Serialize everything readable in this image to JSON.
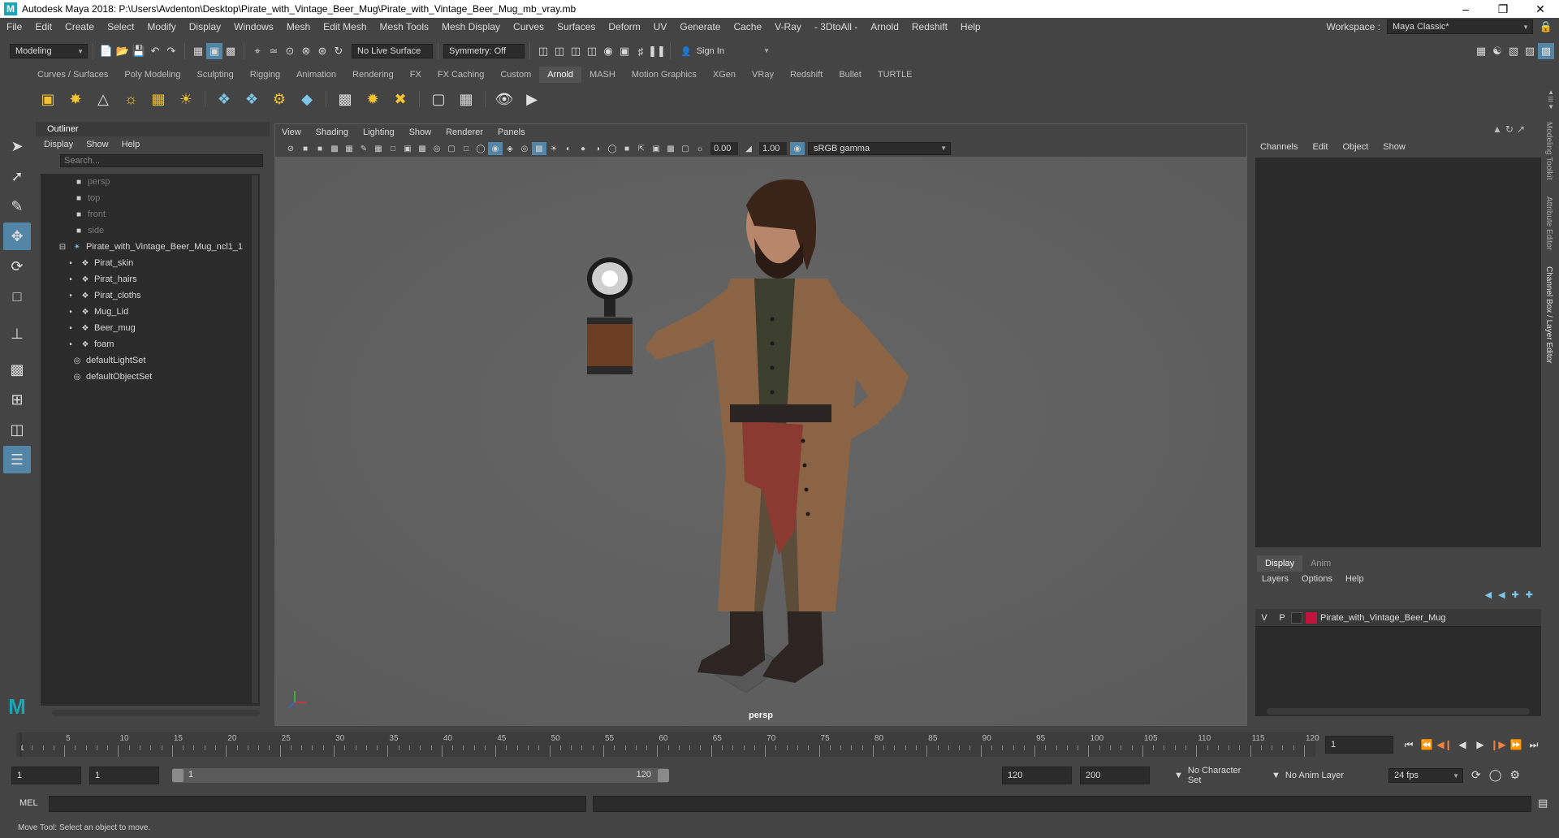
{
  "window": {
    "title": "Autodesk Maya 2018: P:\\Users\\Avdenton\\Desktop\\Pirate_with_Vintage_Beer_Mug\\Pirate_with_Vintage_Beer_Mug_mb_vray.mb"
  },
  "menubar": {
    "items": [
      "File",
      "Edit",
      "Create",
      "Select",
      "Modify",
      "Display",
      "Windows",
      "Mesh",
      "Edit Mesh",
      "Mesh Tools",
      "Mesh Display",
      "Curves",
      "Surfaces",
      "Deform",
      "UV",
      "Generate",
      "Cache",
      "V-Ray",
      "- 3DtoAll -",
      "Arnold",
      "Redshift",
      "Help"
    ],
    "workspace_label": "Workspace :",
    "workspace_value": "Maya Classic*"
  },
  "statusline": {
    "menuset": "Modeling",
    "live_surface": "No Live Surface",
    "symmetry": "Symmetry: Off",
    "sign_in": "Sign In"
  },
  "shelf": {
    "tabs": [
      "Curves / Surfaces",
      "Poly Modeling",
      "Sculpting",
      "Rigging",
      "Animation",
      "Rendering",
      "FX",
      "FX Caching",
      "Custom",
      "Arnold",
      "MASH",
      "Motion Graphics",
      "XGen",
      "VRay",
      "Redshift",
      "Bullet",
      "TURTLE"
    ],
    "active_tab": "Arnold"
  },
  "outliner": {
    "title": "Outliner",
    "menu": [
      "Display",
      "Show",
      "Help"
    ],
    "search_placeholder": "Search...",
    "cameras": [
      "persp",
      "top",
      "front",
      "side"
    ],
    "group": "Pirate_with_Vintage_Beer_Mug_ncl1_1",
    "children": [
      "Pirat_skin",
      "Pirat_hairs",
      "Pirat_cloths",
      "Mug_Lid",
      "Beer_mug",
      "foam"
    ],
    "sets": [
      "defaultLightSet",
      "defaultObjectSet"
    ]
  },
  "viewport": {
    "menu": [
      "View",
      "Shading",
      "Lighting",
      "Show",
      "Renderer",
      "Panels"
    ],
    "exposure": "0.00",
    "gamma": "1.00",
    "color_space": "sRGB gamma",
    "camera_label": "persp"
  },
  "channelbox": {
    "menu": [
      "Channels",
      "Edit",
      "Object",
      "Show"
    ]
  },
  "layereditor": {
    "tabs": [
      "Display",
      "Anim"
    ],
    "active_tab": "Display",
    "menu": [
      "Layers",
      "Options",
      "Help"
    ],
    "layer": {
      "v": "V",
      "p": "P",
      "name": "Pirate_with_Vintage_Beer_Mug",
      "color": "#c0143c"
    }
  },
  "sidetabs": [
    "Modeling Toolkit",
    "Attribute Editor",
    "Channel Box / Layer Editor"
  ],
  "timeslider": {
    "ticks": [
      "5",
      "10",
      "15",
      "20",
      "25",
      "30",
      "35",
      "40",
      "45",
      "50",
      "55",
      "60",
      "65",
      "70",
      "75",
      "80",
      "85",
      "90",
      "95",
      "100",
      "105",
      "110",
      "115",
      "120"
    ],
    "current_frame_marker": "1",
    "current_time": "1"
  },
  "rangeslider": {
    "start": "1",
    "start2": "1",
    "range_start": "1",
    "range_end": "120",
    "end": "120",
    "end2": "200",
    "character_set": "No Character Set",
    "anim_layer": "No Anim Layer",
    "fps": "24 fps"
  },
  "cmdline": {
    "label": "MEL"
  },
  "helpline": {
    "text": "Move Tool: Select an object to move."
  }
}
